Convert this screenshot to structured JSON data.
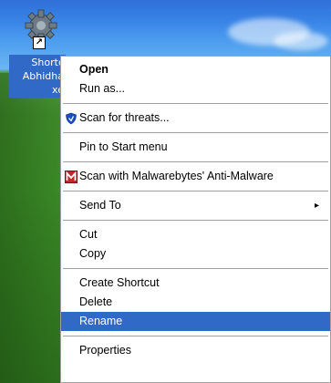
{
  "desktop": {
    "icon": {
      "name": "application-gear-icon",
      "label_lines": [
        "Shortc",
        "Abhidha",
        "xe"
      ]
    }
  },
  "context_menu": {
    "items": [
      {
        "label": "Open",
        "bold": true
      },
      {
        "label": "Run as..."
      },
      {
        "label": "Scan for threats...",
        "icon": "shield-icon"
      },
      {
        "label": "Pin to Start menu"
      },
      {
        "label": "Scan with Malwarebytes' Anti-Malware",
        "icon": "malwarebytes-icon"
      },
      {
        "label": "Send To",
        "submenu": true
      },
      {
        "label": "Cut"
      },
      {
        "label": "Copy"
      },
      {
        "label": "Create Shortcut"
      },
      {
        "label": "Delete"
      },
      {
        "label": "Rename",
        "selected": true
      },
      {
        "label": "Properties"
      }
    ],
    "submenu_arrow": "▸"
  },
  "colors": {
    "selection": "#3169c6",
    "shield": "#1a4fc0",
    "malwarebytes": "#c0282c"
  }
}
